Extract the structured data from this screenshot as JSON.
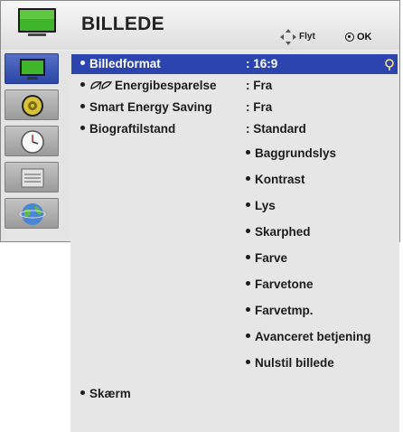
{
  "header": {
    "title": "BILLEDE",
    "move_label": "Flyt",
    "ok_label": "OK"
  },
  "sidebar": {
    "items": [
      {
        "icon": "picture-tv-icon",
        "active": true
      },
      {
        "icon": "audio-speaker-icon",
        "active": false
      },
      {
        "icon": "clock-icon",
        "active": false
      },
      {
        "icon": "options-icon",
        "active": false
      },
      {
        "icon": "network-globe-icon",
        "active": false
      }
    ]
  },
  "menu": {
    "items": [
      {
        "label": "Billedformat",
        "value": ": 16:9",
        "selected": true
      },
      {
        "label": "Energibesparelse",
        "value": ": Fra",
        "icon": "energy-leaf-icon"
      },
      {
        "label": "Smart Energy Saving",
        "value": ": Fra"
      },
      {
        "label": "Biograftilstand",
        "value": ": Standard"
      }
    ],
    "sub_items": [
      "Baggrundslys",
      "Kontrast",
      "Lys",
      "Skarphed",
      "Farve",
      "Farvetone",
      "Farvetmp.",
      "Avanceret betjening",
      "Nulstil billede"
    ],
    "bottom_item": "Skærm"
  },
  "colors": {
    "highlight": "#2c44ad",
    "panel": "#e6e6e6",
    "tv_green": "#3fb52b"
  }
}
